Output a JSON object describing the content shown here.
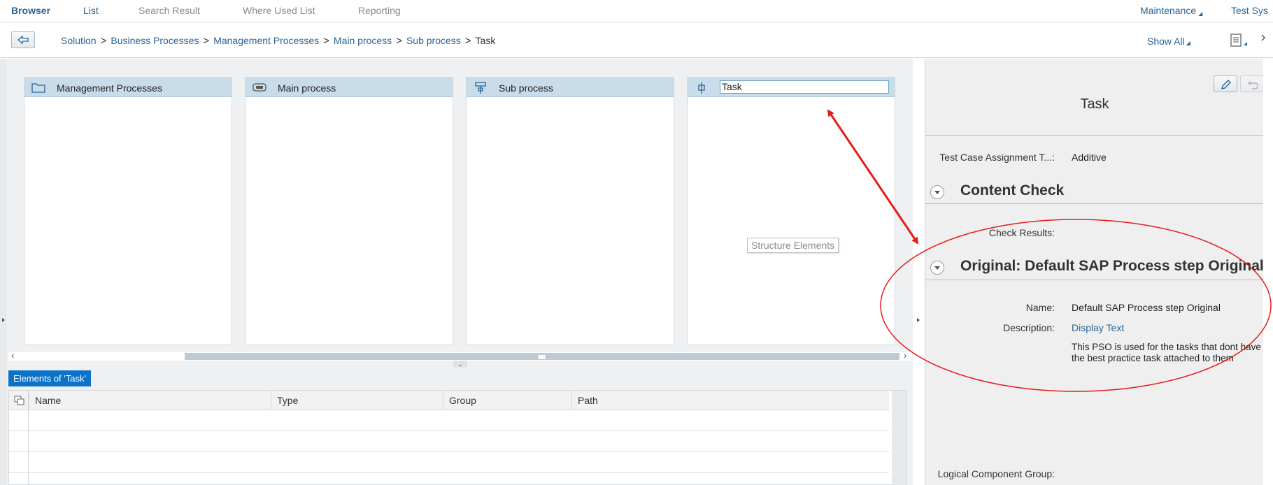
{
  "topbar": {
    "tabs": [
      "Browser",
      "List",
      "Search Result",
      "Where Used List",
      "Reporting"
    ],
    "maintenance": "Maintenance",
    "test_sys": "Test Sys"
  },
  "breadcrumb": {
    "items": [
      "Solution",
      "Business Processes",
      "Management Processes",
      "Main process",
      "Sub process"
    ],
    "current": "Task",
    "separator": ">",
    "show_all": "Show All"
  },
  "columns": [
    {
      "label": "Management Processes",
      "icon": "folder-icon"
    },
    {
      "label": "Main process",
      "icon": "process-icon"
    },
    {
      "label": "Sub process",
      "icon": "subprocess-icon"
    },
    {
      "label": "Task",
      "icon": "task-icon"
    }
  ],
  "tooltip": "Structure Elements",
  "elements_tab": "Elements of 'Task'",
  "table": {
    "headers": [
      "Name",
      "Type",
      "Group",
      "Path"
    ]
  },
  "panel": {
    "title": "Task",
    "fields": {
      "assignment_label": "Test Case Assignment T...:",
      "assignment_value": "Additive"
    },
    "sections": {
      "content_check": "Content Check",
      "original": "Original: Default SAP Process step Original"
    },
    "check_results_label": "Check Results:",
    "name_label": "Name:",
    "name_value": "Default SAP Process step Original",
    "description_label": "Description:",
    "description_link": "Display Text",
    "description_text": "This PSO is used for the tasks that dont have the best practice task attached to them",
    "logical_group_label": "Logical Component Group:"
  },
  "colors": {
    "accent": "#2a6496",
    "column_header": "#c8dcea",
    "tab_active": "#0a73c7",
    "annotation": "#e51c1c"
  }
}
